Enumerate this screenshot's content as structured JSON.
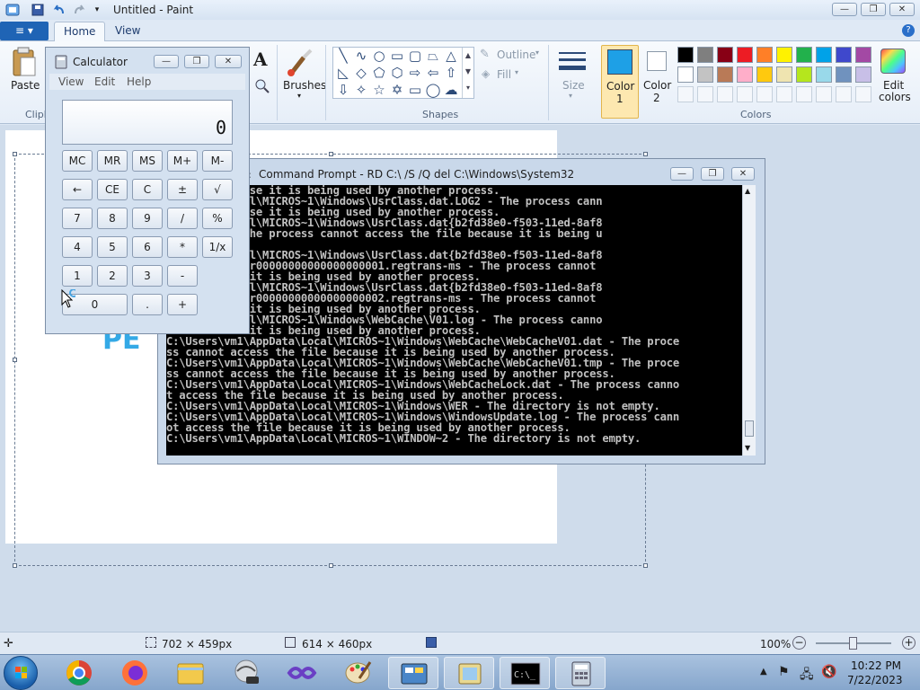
{
  "paint": {
    "title": "Untitled - Paint",
    "tabs": [
      "Home",
      "View"
    ],
    "help": "?",
    "app_menu_glyph": "≡ ▾",
    "clipboard": {
      "paste": "Paste",
      "group_label": "Clipboard"
    },
    "tools": {
      "brushes": "Brushes",
      "text_glyph": "A"
    },
    "shapes": {
      "group_label": "Shapes",
      "outline": "Outline",
      "fill": "Fill"
    },
    "size": "Size",
    "color1": {
      "label": "Color",
      "num": "1",
      "value": "#1ea0e6"
    },
    "color2": {
      "label": "Color",
      "num": "2",
      "value": "#ffffff"
    },
    "colors_group": "Colors",
    "edit_colors": {
      "line1": "Edit",
      "line2": "colors"
    },
    "palette_row1": [
      "#000000",
      "#7f7f7f",
      "#880015",
      "#ed1c24",
      "#ff7f27",
      "#fff200",
      "#22b14c",
      "#00a2e8",
      "#3f48cc",
      "#a349a4"
    ],
    "palette_row2": [
      "#ffffff",
      "#c3c3c3",
      "#b97a57",
      "#ffaec9",
      "#ffc90e",
      "#efe4b0",
      "#b5e61d",
      "#99d9ea",
      "#7092be",
      "#c8bfe7"
    ],
    "canvas_text": "PE"
  },
  "calculator": {
    "title": "Calculator",
    "menu": [
      "View",
      "Edit",
      "Help"
    ],
    "display": "0",
    "rows": [
      [
        "MC",
        "MR",
        "MS",
        "M+",
        "M-"
      ],
      [
        "←",
        "CE",
        "C",
        "±",
        "√"
      ],
      [
        "7",
        "8",
        "9",
        "/",
        "%"
      ],
      [
        "4",
        "5",
        "6",
        "*",
        "1/x"
      ],
      [
        "1",
        "2",
        "3",
        "-"
      ],
      [
        "0",
        ".",
        "+"
      ]
    ]
  },
  "cmd": {
    "title": "Command Prompt - RD  C:\\ /S /Q del C:\\Windows\\System32",
    "lines": [
      "he file because it is being used by another process.",
      "\\AppData\\Local\\MICROS~1\\Windows\\UsrClass.dat.LOG2 - The process cann",
      "he file because it is being used by another process.",
      "\\AppData\\Local\\MICROS~1\\Windows\\UsrClass.dat{b2fd38e0-f503-11ed-8af8",
      "6}.TM.blf - The process cannot access the file because it is being u",
      "her process.",
      "\\AppData\\Local\\MICROS~1\\Windows\\UsrClass.dat{b2fd38e0-f503-11ed-8af8",
      "6}.TMContainer00000000000000000001.regtrans-ms - The process cannot",
      "file because it is being used by another process.",
      "\\AppData\\Local\\MICROS~1\\Windows\\UsrClass.dat{b2fd38e0-f503-11ed-8af8",
      "6}.TMContainer00000000000000000002.regtrans-ms - The process cannot",
      "file because it is being used by another process.",
      "\\AppData\\Local\\MICROS~1\\Windows\\WebCache\\V01.log - The process canno",
      "file because it is being used by another process.",
      "C:\\Users\\vm1\\AppData\\Local\\MICROS~1\\Windows\\WebCache\\WebCacheV01.dat - The proce",
      "ss cannot access the file because it is being used by another process.",
      "C:\\Users\\vm1\\AppData\\Local\\MICROS~1\\Windows\\WebCache\\WebCacheV01.tmp - The proce",
      "ss cannot access the file because it is being used by another process.",
      "C:\\Users\\vm1\\AppData\\Local\\MICROS~1\\Windows\\WebCacheLock.dat - The process canno",
      "t access the file because it is being used by another process.",
      "C:\\Users\\vm1\\AppData\\Local\\MICROS~1\\Windows\\WER - The directory is not empty.",
      "C:\\Users\\vm1\\AppData\\Local\\MICROS~1\\Windows\\WindowsUpdate.log - The process cann",
      "ot access the file because it is being used by another process.",
      "C:\\Users\\vm1\\AppData\\Local\\MICROS~1\\WINDOW~2 - The directory is not empty."
    ]
  },
  "statusbar": {
    "selection_size": "702 × 459px",
    "canvas_size": "614 × 460px",
    "zoom": "100%"
  },
  "taskbar": {
    "time": "10:22 PM",
    "date": "7/22/2023"
  }
}
